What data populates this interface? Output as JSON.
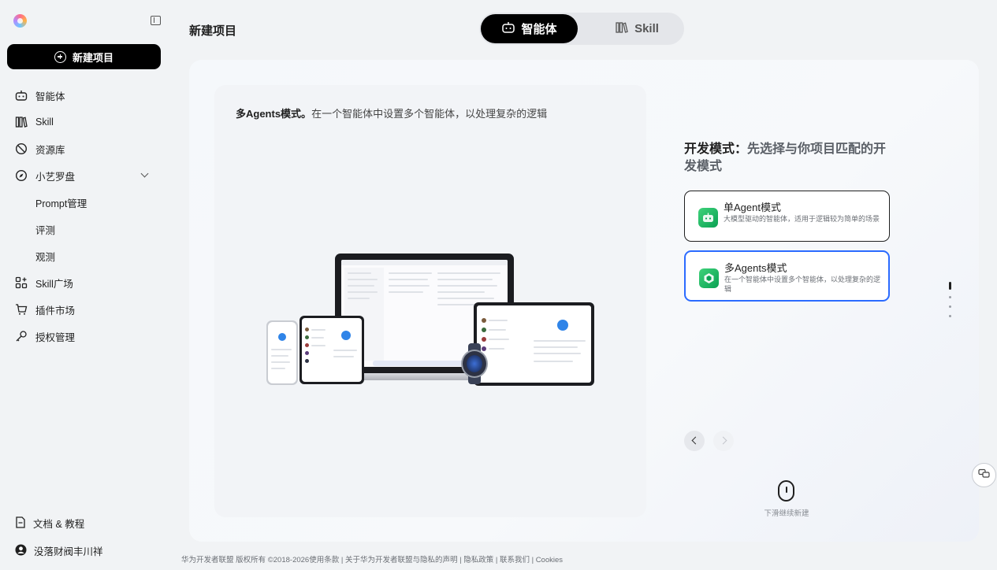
{
  "sidebar": {
    "new_project_label": "新建项目",
    "items": [
      {
        "label": "智能体",
        "icon": "robot-icon"
      },
      {
        "label": "Skill",
        "icon": "books-icon"
      },
      {
        "label": "资源库",
        "icon": "leaf-icon"
      },
      {
        "label": "小艺罗盘",
        "icon": "compass-icon",
        "expanded": true
      },
      {
        "label": "Prompt管理"
      },
      {
        "label": "评测"
      },
      {
        "label": "观测"
      },
      {
        "label": "Skill广场",
        "icon": "grid-plus-icon"
      },
      {
        "label": "插件市场",
        "icon": "cart-icon"
      },
      {
        "label": "授权管理",
        "icon": "key-icon"
      }
    ],
    "docs_label": "文档 & 教程",
    "user_name": "没落财阀丰川祥"
  },
  "header": {
    "title": "新建项目",
    "tabs": [
      {
        "label": "智能体",
        "active": true
      },
      {
        "label": "Skill",
        "active": false
      }
    ]
  },
  "preview": {
    "caption_bold": "多Agents模式。",
    "caption_rest": "在一个智能体中设置多个智能体，以处理复杂的逻辑"
  },
  "dev_mode": {
    "title_bold": "开发模式：",
    "title_rest": "先选择与你项目匹配的开发模式",
    "options": [
      {
        "title": "单Agent模式",
        "desc": "大模型驱动的智能体，适用于逻辑较为简单的场景",
        "selected": false
      },
      {
        "title": "多Agents模式",
        "desc": "在一个智能体中设置多个智能体，以处理复杂的逻辑",
        "selected": true
      }
    ]
  },
  "scroll_hint": "下滑继续新建",
  "footer": "华为开发者联盟 版权所有 ©2018-2026使用条款 | 关于华为开发者联盟与隐私的声明 | 隐私政策 | 联系我们 | Cookies",
  "colors": {
    "accent": "#2b6bff",
    "primary_button": "#000000",
    "mode_icon_green": "#0aa153"
  }
}
